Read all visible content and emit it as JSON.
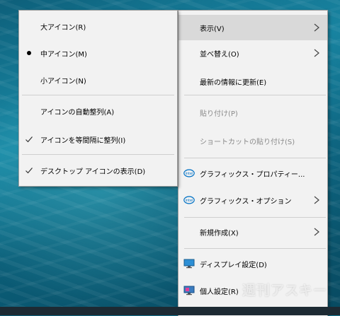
{
  "main_menu": {
    "items": [
      {
        "label": "表示(V)",
        "has_submenu": true,
        "highlighted": true
      },
      {
        "label": "並べ替え(O)",
        "has_submenu": true
      },
      {
        "label": "最新の情報に更新(E)"
      },
      {
        "label": "貼り付け(P)",
        "disabled": true
      },
      {
        "label": "ショートカットの貼り付け(S)",
        "disabled": true
      },
      {
        "label": "グラフィックス・プロパティー...",
        "icon": "intel-graphics-icon"
      },
      {
        "label": "グラフィックス・オプション",
        "icon": "intel-graphics-icon",
        "has_submenu": true
      },
      {
        "label": "新規作成(X)",
        "has_submenu": true
      },
      {
        "label": "ディスプレイ設定(D)",
        "icon": "display-settings-icon"
      },
      {
        "label": "個人設定(R)",
        "icon": "personalize-icon"
      }
    ]
  },
  "view_submenu": {
    "items": [
      {
        "label": "大アイコン(R)"
      },
      {
        "label": "中アイコン(M)",
        "mark": "bullet"
      },
      {
        "label": "小アイコン(N)"
      },
      {
        "label": "アイコンの自動整列(A)"
      },
      {
        "label": "アイコンを等間隔に整列(I)",
        "mark": "check"
      },
      {
        "label": "デスクトップ アイコンの表示(D)",
        "mark": "check"
      }
    ]
  },
  "icon_text": {
    "intel": "intel"
  },
  "watermark": "週刊アスキー",
  "colors": {
    "menu_bg": "#f2f2f2",
    "highlight": "#d9d9d9",
    "disabled_text": "#8a8a8a"
  }
}
